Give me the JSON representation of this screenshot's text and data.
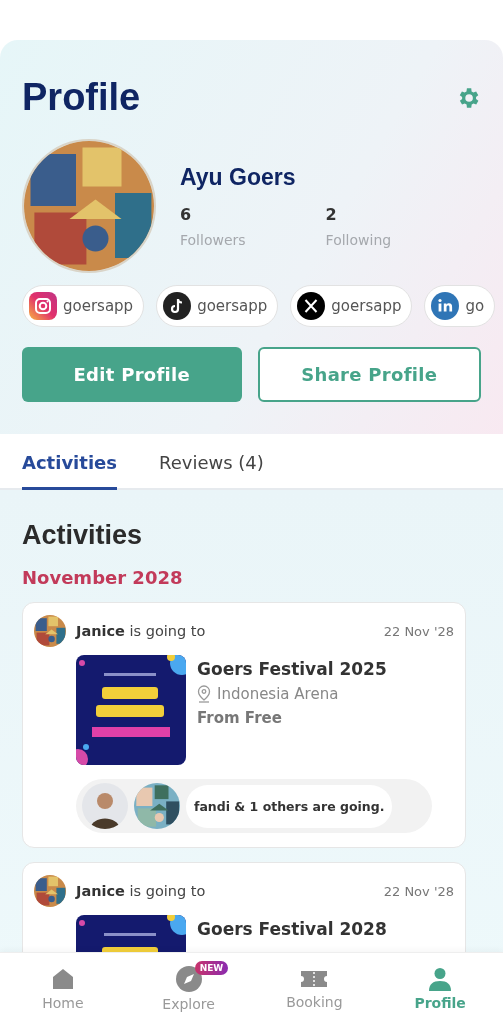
{
  "header": {
    "title": "Profile"
  },
  "profile": {
    "name": "Ayu Goers",
    "stats": [
      {
        "value": "6",
        "label": "Followers"
      },
      {
        "value": "2",
        "label": "Following"
      }
    ]
  },
  "socials": [
    {
      "kind": "instagram",
      "handle": "goersapp"
    },
    {
      "kind": "tiktok",
      "handle": "goersapp"
    },
    {
      "kind": "x",
      "handle": "goersapp"
    },
    {
      "kind": "linkedin",
      "handle": "go"
    }
  ],
  "buttons": [
    {
      "kind": "primary",
      "label": "Edit Profile"
    },
    {
      "kind": "outline",
      "label": "Share Profile"
    }
  ],
  "tabs": [
    {
      "label": "Activities",
      "selected": true
    },
    {
      "label": "Reviews (4)",
      "selected": false
    }
  ],
  "section_title": "Activities",
  "month": "November 2028",
  "activities": [
    {
      "actor": "**Janice** is going to",
      "date": "22 Nov '28",
      "event": "Goers Festival 2025",
      "venue": "Indonesia Arena",
      "price": "From Free",
      "attendees": "fandi & 1 others are going."
    },
    {
      "actor": "**Janice** is going to",
      "date": "22 Nov '28",
      "event": "Goers Festival 2028"
    }
  ],
  "nav": [
    {
      "kind": "home",
      "label": "Home",
      "selected": false
    },
    {
      "kind": "explore",
      "label": "Explore",
      "selected": false,
      "badge": "NEW"
    },
    {
      "kind": "booking",
      "label": "Booking",
      "selected": false
    },
    {
      "kind": "profile",
      "label": "Profile",
      "selected": true
    }
  ]
}
